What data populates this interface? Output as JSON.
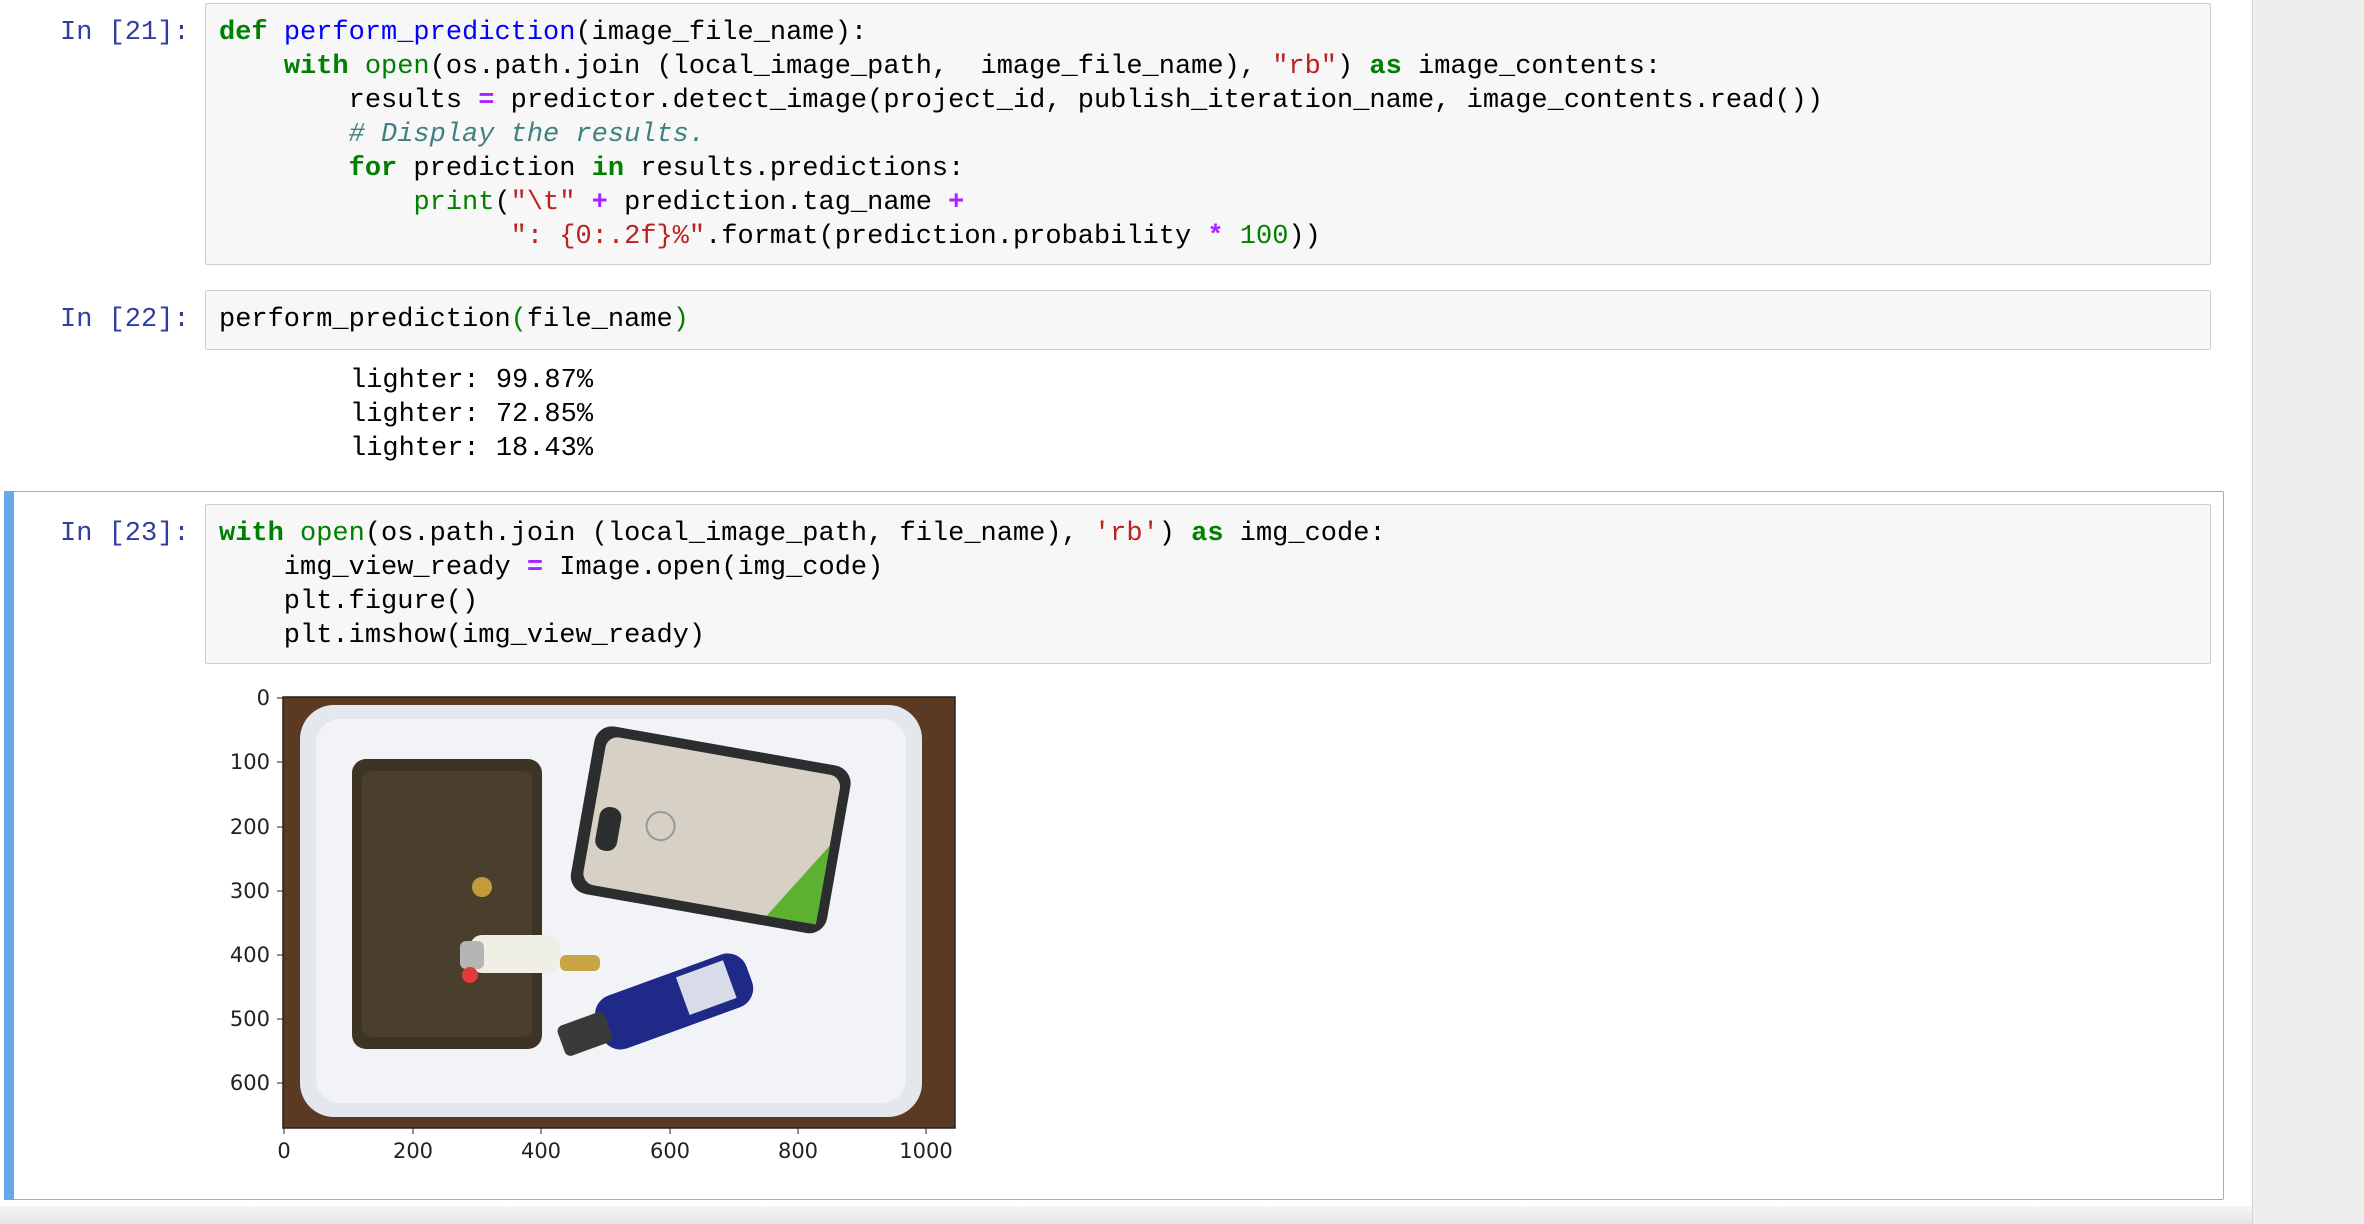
{
  "cells": [
    {
      "prompt": "In [21]:",
      "code_lines": [
        "def perform_prediction(image_file_name):",
        "    with open(os.path.join (local_image_path,  image_file_name), \"rb\") as image_contents:",
        "        results = predictor.detect_image(project_id, publish_iteration_name, image_contents.read())",
        "        # Display the results.",
        "        for prediction in results.predictions:",
        "            print(\"\\t\" + prediction.tag_name +",
        "                  \": {0:.2f}%\".format(prediction.probability * 100))"
      ]
    },
    {
      "prompt": "In [22]:",
      "code_lines": [
        "perform_prediction(file_name)"
      ],
      "output_lines": [
        "lighter: 99.87%",
        "lighter: 72.85%",
        "lighter: 18.43%"
      ]
    },
    {
      "prompt": "In [23]:",
      "code_lines": [
        "with open(os.path.join (local_image_path, file_name), 'rb') as img_code:",
        "    img_view_ready = Image.open(img_code)",
        "    plt.figure()",
        "    plt.imshow(img_view_ready)"
      ]
    }
  ],
  "chart_data": {
    "type": "image",
    "x_ticks": [
      "0",
      "200",
      "400",
      "600",
      "800",
      "1000"
    ],
    "y_ticks": [
      "0",
      "100",
      "200",
      "300",
      "400",
      "500",
      "600"
    ],
    "xlim": [
      0,
      1045
    ],
    "ylim": [
      672,
      0
    ],
    "image_subject": "tray-with-wallet-phone-lighter-and-spray-bottle"
  }
}
